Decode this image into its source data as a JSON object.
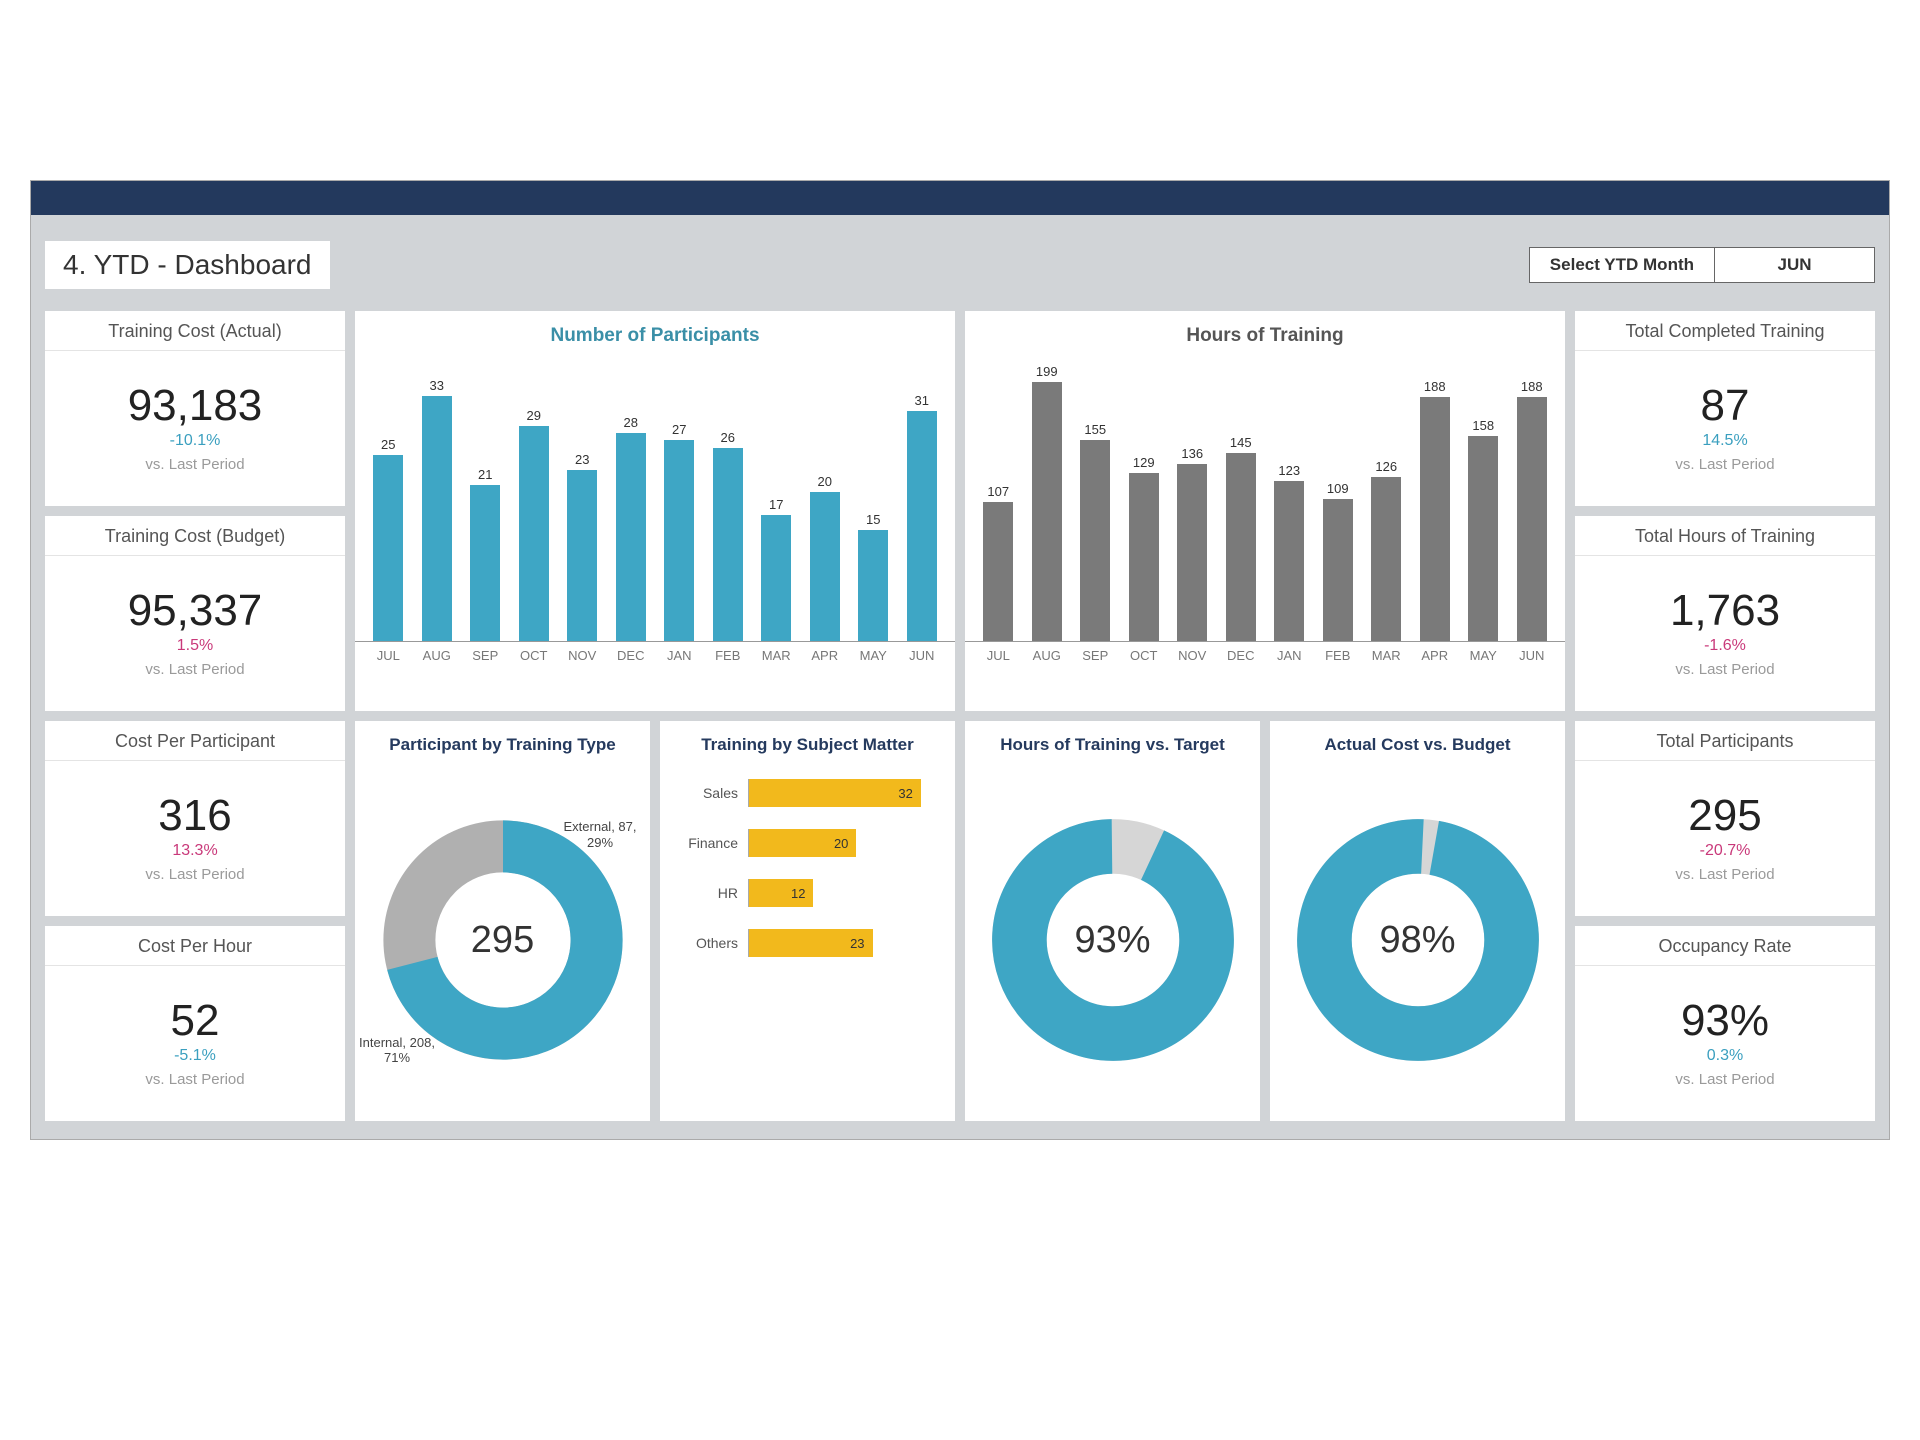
{
  "header": {
    "title": "4. YTD - Dashboard",
    "select_label": "Select YTD Month",
    "select_value": "JUN"
  },
  "kpis_left": [
    {
      "title": "Training Cost (Actual)",
      "value": "93,183",
      "delta": "-10.1%",
      "delta_cls": "teal",
      "sub": "vs. Last Period"
    },
    {
      "title": "Training Cost (Budget)",
      "value": "95,337",
      "delta": "1.5%",
      "delta_cls": "pink",
      "sub": "vs. Last Period"
    },
    {
      "title": "Cost Per Participant",
      "value": "316",
      "delta": "13.3%",
      "delta_cls": "pink",
      "sub": "vs. Last Period"
    },
    {
      "title": "Cost Per Hour",
      "value": "52",
      "delta": "-5.1%",
      "delta_cls": "teal",
      "sub": "vs. Last Period"
    }
  ],
  "kpis_right": [
    {
      "title": "Total Completed Training",
      "value": "87",
      "delta": "14.5%",
      "delta_cls": "teal",
      "sub": "vs. Last Period"
    },
    {
      "title": "Total Hours of Training",
      "value": "1,763",
      "delta": "-1.6%",
      "delta_cls": "pink",
      "sub": "vs. Last Period"
    },
    {
      "title": "Total Participants",
      "value": "295",
      "delta": "-20.7%",
      "delta_cls": "pink",
      "sub": "vs. Last Period"
    },
    {
      "title": "Occupancy Rate",
      "value": "93%",
      "delta": "0.3%",
      "delta_cls": "teal",
      "sub": "vs. Last Period"
    }
  ],
  "participants_chart": {
    "title": "Number of Participants",
    "months": [
      "JUL",
      "AUG",
      "SEP",
      "OCT",
      "NOV",
      "DEC",
      "JAN",
      "FEB",
      "MAR",
      "APR",
      "MAY",
      "JUN"
    ],
    "values": [
      25,
      33,
      21,
      29,
      23,
      28,
      27,
      26,
      17,
      20,
      15,
      31
    ]
  },
  "hours_chart": {
    "title": "Hours of Training",
    "months": [
      "JUL",
      "AUG",
      "SEP",
      "OCT",
      "NOV",
      "DEC",
      "JAN",
      "FEB",
      "MAR",
      "APR",
      "MAY",
      "JUN"
    ],
    "values": [
      107,
      199,
      155,
      129,
      136,
      145,
      123,
      109,
      126,
      188,
      158,
      188
    ]
  },
  "participant_type": {
    "title": "Participant by Training Type",
    "center": "295",
    "external_label": "External, 87, 29%",
    "internal_label": "Internal, 208, 71%"
  },
  "subject_matter": {
    "title": "Training by Subject Matter",
    "rows": [
      {
        "cat": "Sales",
        "val": 32
      },
      {
        "cat": "Finance",
        "val": 20
      },
      {
        "cat": "HR",
        "val": 12
      },
      {
        "cat": "Others",
        "val": 23
      }
    ]
  },
  "gauge_hours": {
    "title": "Hours of Training vs. Target",
    "pct": "93%",
    "deg": 335
  },
  "gauge_cost": {
    "title": "Actual Cost vs. Budget",
    "pct": "98%",
    "deg": 353
  },
  "chart_data": [
    {
      "type": "bar",
      "title": "Number of Participants",
      "categories": [
        "JUL",
        "AUG",
        "SEP",
        "OCT",
        "NOV",
        "DEC",
        "JAN",
        "FEB",
        "MAR",
        "APR",
        "MAY",
        "JUN"
      ],
      "values": [
        25,
        33,
        21,
        29,
        23,
        28,
        27,
        26,
        17,
        20,
        15,
        31
      ],
      "xlabel": "",
      "ylabel": "",
      "ylim": [
        0,
        35
      ]
    },
    {
      "type": "bar",
      "title": "Hours of Training",
      "categories": [
        "JUL",
        "AUG",
        "SEP",
        "OCT",
        "NOV",
        "DEC",
        "JAN",
        "FEB",
        "MAR",
        "APR",
        "MAY",
        "JUN"
      ],
      "values": [
        107,
        199,
        155,
        129,
        136,
        145,
        123,
        109,
        126,
        188,
        158,
        188
      ],
      "xlabel": "",
      "ylabel": "",
      "ylim": [
        0,
        200
      ]
    },
    {
      "type": "pie",
      "title": "Participant by Training Type",
      "series": [
        {
          "name": "Internal",
          "values": [
            208
          ]
        },
        {
          "name": "External",
          "values": [
            87
          ]
        }
      ],
      "annotations": [
        "Internal, 208, 71%",
        "External, 87, 29%"
      ],
      "center_label": "295"
    },
    {
      "type": "bar",
      "title": "Training by Subject Matter",
      "orientation": "horizontal",
      "categories": [
        "Sales",
        "Finance",
        "HR",
        "Others"
      ],
      "values": [
        32,
        20,
        12,
        23
      ],
      "xlim": [
        0,
        35
      ]
    },
    {
      "type": "pie",
      "title": "Hours of Training vs. Target",
      "series": [
        {
          "name": "Achieved",
          "values": [
            93
          ]
        },
        {
          "name": "Remaining",
          "values": [
            7
          ]
        }
      ],
      "center_label": "93%"
    },
    {
      "type": "pie",
      "title": "Actual Cost vs. Budget",
      "series": [
        {
          "name": "Actual",
          "values": [
            98
          ]
        },
        {
          "name": "Remaining",
          "values": [
            2
          ]
        }
      ],
      "center_label": "98%"
    }
  ]
}
